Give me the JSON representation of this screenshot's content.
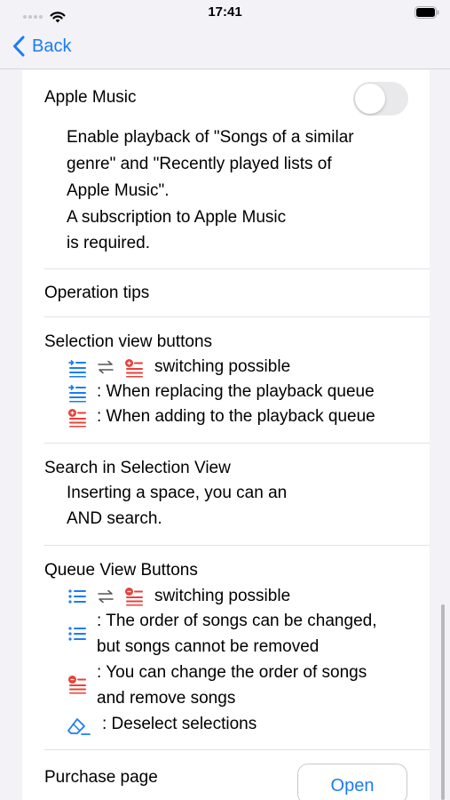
{
  "status_bar": {
    "time": "17:41",
    "icons": [
      "signal-dots-icon",
      "wifi-icon",
      "battery-icon"
    ]
  },
  "nav": {
    "back_label": "Back",
    "back_icon": "chevron-left-icon"
  },
  "apple_music": {
    "title": "Apple Music",
    "toggle_on": false,
    "desc": [
      "Enable playback of \"Songs of a similar",
      "genre\" and \"Recently played lists of",
      "Apple Music\".",
      "A subscription to Apple Music",
      "is required."
    ]
  },
  "operation_tips": {
    "title": "Operation tips"
  },
  "selection_buttons": {
    "title": "Selection view buttons",
    "switch_text": "switching possible",
    "replace_text": ": When replacing the playback queue",
    "add_text": ": When adding to the playback queue",
    "icons": [
      "replace-queue-icon",
      "swap-arrows-icon",
      "add-queue-icon"
    ]
  },
  "search": {
    "title": "Search in Selection View",
    "desc": [
      "Inserting a space, you can an",
      "AND search."
    ]
  },
  "queue_buttons": {
    "title": "Queue View Buttons",
    "switch_text": "switching possible",
    "reorder_text": [
      ": The order of songs can be changed,",
      "but songs cannot be removed"
    ],
    "remove_text": [
      ": You can change the order of songs",
      "and remove songs"
    ],
    "deselect_text": ": Deselect selections",
    "icons": [
      "list-icon",
      "swap-arrows-icon",
      "remove-list-icon",
      "eraser-icon"
    ]
  },
  "purchase": {
    "title": "Purchase page",
    "button_label": "Open"
  },
  "colors": {
    "accent": "#1a7cf5",
    "red": "#e8403a",
    "background": "#f2f2f7"
  }
}
